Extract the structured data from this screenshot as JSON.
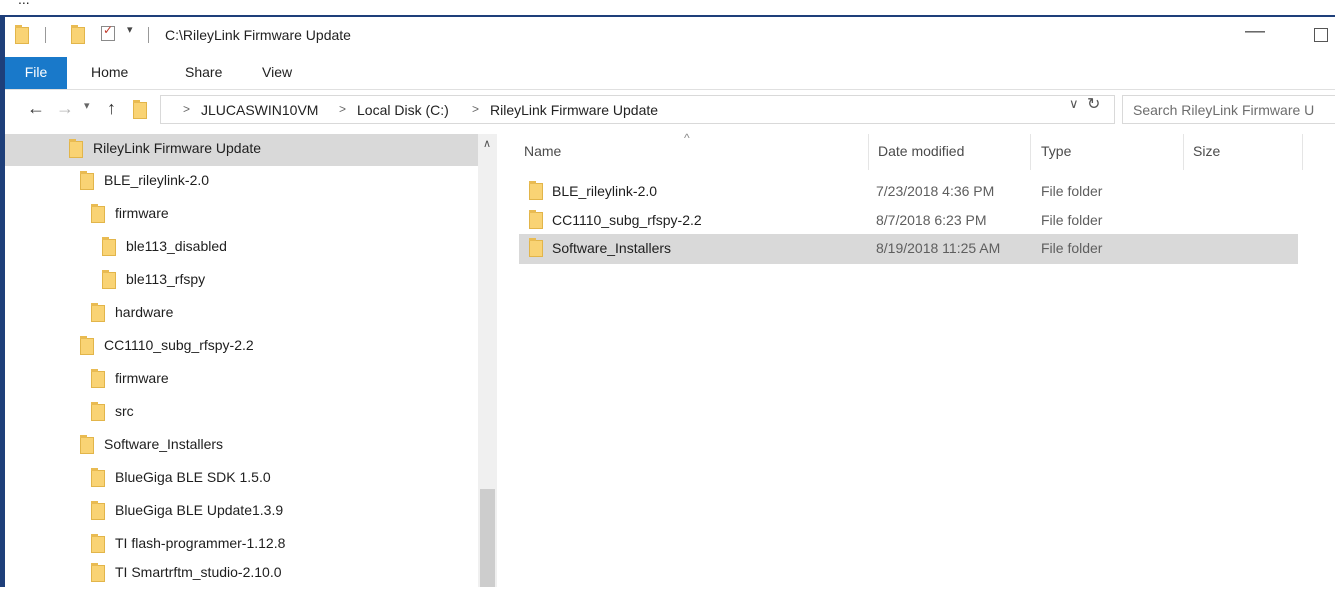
{
  "window": {
    "title": "C:\\RileyLink Firmware Update"
  },
  "top_strip": {
    "text": "..."
  },
  "ribbon": {
    "tabs": [
      {
        "label": "File"
      },
      {
        "label": "Home"
      },
      {
        "label": "Share"
      },
      {
        "label": "View"
      }
    ]
  },
  "address": {
    "crumbs": [
      "JLUCASWIN10VM",
      "Local Disk (C:)",
      "RileyLink Firmware Update"
    ],
    "separator": ">",
    "search_placeholder": "Search RileyLink Firmware U"
  },
  "nav_tree": [
    {
      "label": "RileyLink Firmware Update",
      "selected": true
    },
    {
      "label": "BLE_rileylink-2.0"
    },
    {
      "label": "firmware"
    },
    {
      "label": "ble113_disabled"
    },
    {
      "label": "ble113_rfspy"
    },
    {
      "label": "hardware"
    },
    {
      "label": "CC1110_subg_rfspy-2.2"
    },
    {
      "label": "firmware"
    },
    {
      "label": "src"
    },
    {
      "label": "Software_Installers"
    },
    {
      "label": "BlueGiga BLE SDK 1.5.0"
    },
    {
      "label": "BlueGiga BLE Update1.3.9"
    },
    {
      "label": "TI flash-programmer-1.12.8"
    },
    {
      "label": "TI Smartrftm_studio-2.10.0"
    }
  ],
  "columns": {
    "name": "Name",
    "date": "Date modified",
    "type": "Type",
    "size": "Size"
  },
  "files": [
    {
      "name": "BLE_rileylink-2.0",
      "date": "7/23/2018 4:36 PM",
      "type": "File folder"
    },
    {
      "name": "CC1110_subg_rfspy-2.2",
      "date": "8/7/2018 6:23 PM",
      "type": "File folder"
    },
    {
      "name": "Software_Installers",
      "date": "8/19/2018 11:25 AM",
      "type": "File folder",
      "selected": true
    }
  ],
  "icons": {
    "folder": "folder-icon",
    "back": "back-arrow-icon",
    "forward": "forward-arrow-icon",
    "up": "up-arrow-icon",
    "refresh": "refresh-icon",
    "minimize": "minimize-icon",
    "maximize": "maximize-icon"
  },
  "colors": {
    "file_tab": "#1979ca",
    "selection": "#d9d9d9",
    "folder": "#f9d374",
    "window_border": "#1e3f7a"
  }
}
